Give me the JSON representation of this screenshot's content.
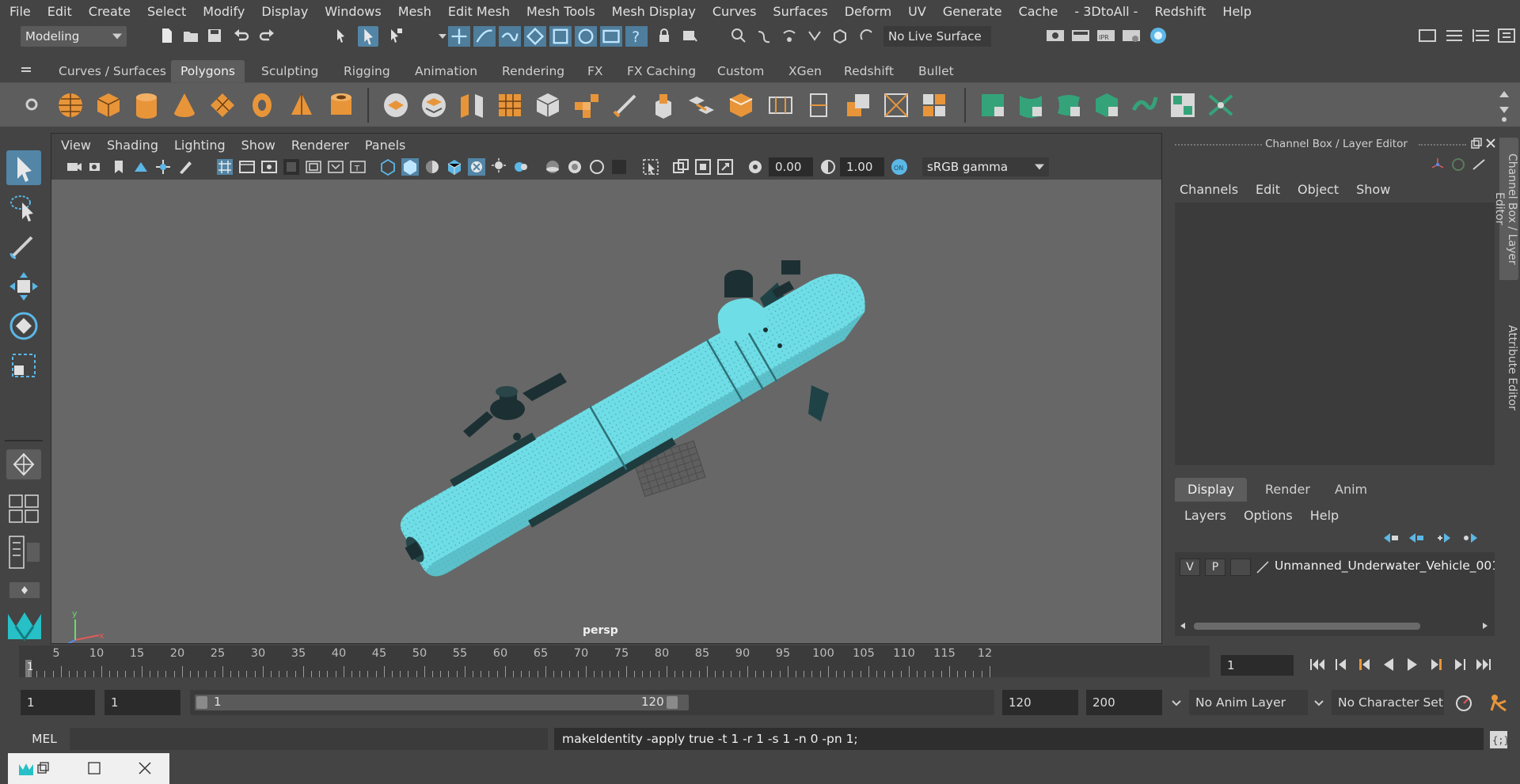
{
  "menubar": {
    "items": [
      "File",
      "Edit",
      "Create",
      "Select",
      "Modify",
      "Display",
      "Windows",
      "Mesh",
      "Edit Mesh",
      "Mesh Tools",
      "Mesh Display",
      "Curves",
      "Surfaces",
      "Deform",
      "UV",
      "Generate",
      "Cache",
      "- 3DtoAll -",
      "Redshift",
      "Help"
    ]
  },
  "statusline": {
    "mode": "Modeling",
    "live_surface": "No Live Surface"
  },
  "shelf": {
    "tabs": [
      "Curves / Surfaces",
      "Polygons",
      "Sculpting",
      "Rigging",
      "Animation",
      "Rendering",
      "FX",
      "FX Caching",
      "Custom",
      "XGen",
      "Redshift",
      "Bullet"
    ],
    "active_tab": "Polygons"
  },
  "viewport": {
    "menu": [
      "View",
      "Shading",
      "Lighting",
      "Show",
      "Renderer",
      "Panels"
    ],
    "exposure": "0.00",
    "gamma": "1.00",
    "color_space": "sRGB gamma",
    "camera_label": "persp",
    "axis_x": "x",
    "axis_y": "y",
    "axis_z": "z",
    "model_color": "#6fdde6"
  },
  "channel_box": {
    "title": "Channel Box / Layer Editor",
    "menu": [
      "Channels",
      "Edit",
      "Object",
      "Show"
    ]
  },
  "layer_editor": {
    "tabs": [
      "Display",
      "Render",
      "Anim"
    ],
    "active_tab": "Display",
    "menu": [
      "Layers",
      "Options",
      "Help"
    ],
    "layers": [
      {
        "v": "V",
        "p": "P",
        "name": "Unmanned_Underwater_Vehicle_001"
      }
    ]
  },
  "side_tabs": [
    "Channel Box / Layer Editor",
    "Attribute Editor"
  ],
  "timeline": {
    "ticks": [
      "5",
      "10",
      "15",
      "20",
      "25",
      "30",
      "35",
      "40",
      "45",
      "50",
      "55",
      "60",
      "65",
      "70",
      "75",
      "80",
      "85",
      "90",
      "95",
      "100",
      "105",
      "110",
      "115",
      "12"
    ],
    "current_frame_marker": "1",
    "current_frame_field": "1"
  },
  "range": {
    "start": "1",
    "playback_start": "1",
    "slider_start": "1",
    "slider_end": "120",
    "playback_end": "120",
    "end": "200",
    "anim_layer": "No Anim Layer",
    "character_set": "No Character Set"
  },
  "command_line": {
    "language": "MEL",
    "output": "makeIdentity -apply true -t 1 -r 1 -s 1 -n 0 -pn 1;"
  }
}
